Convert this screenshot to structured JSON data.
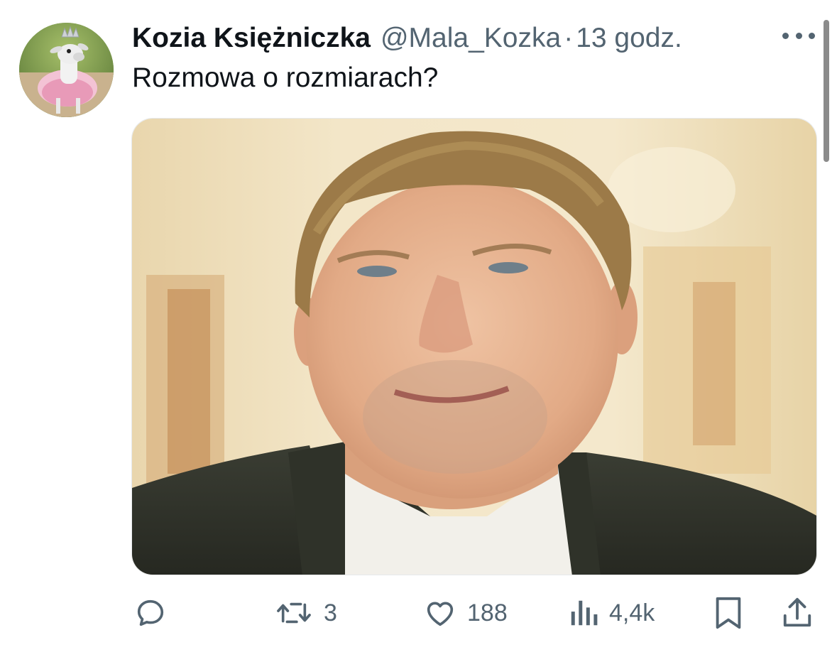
{
  "tweet": {
    "author": {
      "display_name": "Kozia Księżniczka",
      "handle": "@Mala_Kozka",
      "avatar_icon": "goat-with-crown-avatar"
    },
    "separator": "·",
    "time": "13 godz.",
    "text": "Rozmowa o rozmiarach?",
    "media": {
      "type": "photo",
      "icon": "photo-of-smiling-man-in-suit"
    }
  },
  "actions": {
    "reply": {
      "icon": "reply-icon",
      "count": ""
    },
    "retweet": {
      "icon": "retweet-icon",
      "count": "3"
    },
    "like": {
      "icon": "heart-icon",
      "count": "188"
    },
    "views": {
      "icon": "views-bar-chart-icon",
      "count": "4,4k"
    },
    "bookmark": {
      "icon": "bookmark-icon"
    },
    "share": {
      "icon": "share-icon"
    }
  },
  "colors": {
    "text_primary": "#0f1419",
    "text_secondary": "#536471",
    "background": "#ffffff"
  }
}
